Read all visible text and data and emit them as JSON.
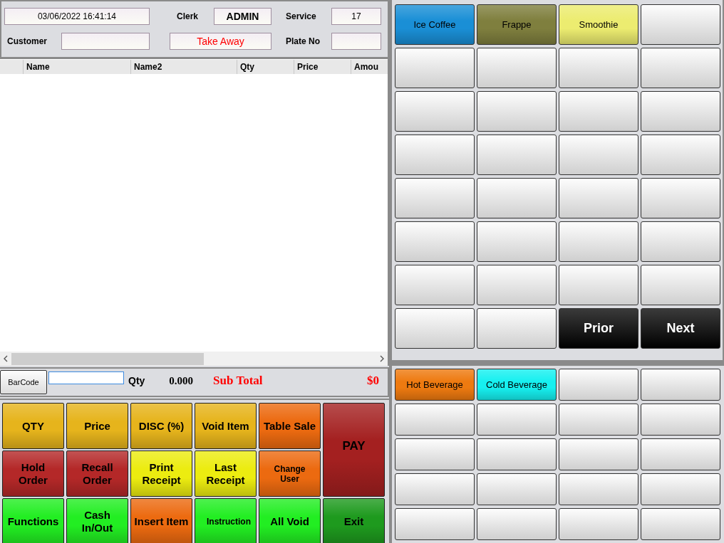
{
  "header": {
    "datetime": "03/06/2022 16:41:14",
    "clerk_label": "Clerk",
    "clerk": "ADMIN",
    "service_label": "Service",
    "service": "17",
    "customer_label": "Customer",
    "order_type": "Take Away",
    "plate_label": "Plate No"
  },
  "table": {
    "columns": [
      "Name",
      "Name2",
      "Qty",
      "Price",
      "Amou"
    ]
  },
  "entry_bar": {
    "barcode_button": "BarCode",
    "qty_label": "Qty",
    "qty": "0.000",
    "subtotal_label": "Sub Total",
    "subtotal": "$0"
  },
  "function_buttons": [
    {
      "label": "QTY",
      "color": "#e6b41c",
      "kind": "normal"
    },
    {
      "label": "Price",
      "color": "#e6b41c",
      "kind": "normal"
    },
    {
      "label": "DISC (%)",
      "color": "#e6b41c",
      "kind": "normal"
    },
    {
      "label": "Void Item",
      "color": "#e6b41c",
      "kind": "normal"
    },
    {
      "label": "Table Sale",
      "color": "#ec6a10",
      "kind": "normal"
    },
    {
      "label": "PAY",
      "color": "#a42020",
      "kind": "tall"
    },
    {
      "label": "Hold Order",
      "color": "#b42828",
      "kind": "normal"
    },
    {
      "label": "Recall Order",
      "color": "#b42828",
      "kind": "normal"
    },
    {
      "label": "Print Receipt",
      "color": "#ecec10",
      "kind": "normal"
    },
    {
      "label": "Last Receipt",
      "color": "#ecec10",
      "kind": "normal"
    },
    {
      "label": "Change User",
      "color": "#ec6a10",
      "kind": "small"
    },
    {
      "label": "Functions",
      "color": "#22ee22",
      "kind": "normal"
    },
    {
      "label": "Cash In/Out",
      "color": "#22ee22",
      "kind": "normal"
    },
    {
      "label": "Insert Item",
      "color": "#ec6a10",
      "kind": "normal"
    },
    {
      "label": "Instruction",
      "color": "#22ee22",
      "kind": "small"
    },
    {
      "label": "All Void",
      "color": "#22ee22",
      "kind": "normal"
    },
    {
      "label": "Exit",
      "color": "#1e9a1e",
      "kind": "normal"
    }
  ],
  "product_buttons": [
    {
      "kind": "item",
      "label": "Ice Coffee",
      "color": "#1a8fd6"
    },
    {
      "kind": "item",
      "label": "Frappe",
      "color": "#7f7f3e"
    },
    {
      "kind": "item",
      "label": "Smoothie",
      "color": "#ecec70"
    },
    {
      "kind": "empty"
    },
    {
      "kind": "empty"
    },
    {
      "kind": "empty"
    },
    {
      "kind": "empty"
    },
    {
      "kind": "empty"
    },
    {
      "kind": "empty"
    },
    {
      "kind": "empty"
    },
    {
      "kind": "empty"
    },
    {
      "kind": "empty"
    },
    {
      "kind": "empty"
    },
    {
      "kind": "empty"
    },
    {
      "kind": "empty"
    },
    {
      "kind": "empty"
    },
    {
      "kind": "empty"
    },
    {
      "kind": "empty"
    },
    {
      "kind": "empty"
    },
    {
      "kind": "empty"
    },
    {
      "kind": "empty"
    },
    {
      "kind": "empty"
    },
    {
      "kind": "empty"
    },
    {
      "kind": "empty"
    },
    {
      "kind": "empty"
    },
    {
      "kind": "empty"
    },
    {
      "kind": "empty"
    },
    {
      "kind": "empty"
    },
    {
      "kind": "empty"
    },
    {
      "kind": "empty"
    },
    {
      "kind": "nav",
      "label": "Prior"
    },
    {
      "kind": "nav",
      "label": "Next"
    }
  ],
  "category_buttons": [
    {
      "kind": "item",
      "label": "Hot Beverage",
      "color": "#ee7a10"
    },
    {
      "kind": "item",
      "label": "Cold Beverage",
      "color": "#16f0f0"
    },
    {
      "kind": "empty"
    },
    {
      "kind": "empty"
    },
    {
      "kind": "empty"
    },
    {
      "kind": "empty"
    },
    {
      "kind": "empty"
    },
    {
      "kind": "empty"
    },
    {
      "kind": "empty"
    },
    {
      "kind": "empty"
    },
    {
      "kind": "empty"
    },
    {
      "kind": "empty"
    },
    {
      "kind": "empty"
    },
    {
      "kind": "empty"
    },
    {
      "kind": "empty"
    },
    {
      "kind": "empty"
    },
    {
      "kind": "empty"
    },
    {
      "kind": "empty"
    },
    {
      "kind": "empty"
    },
    {
      "kind": "empty"
    }
  ]
}
